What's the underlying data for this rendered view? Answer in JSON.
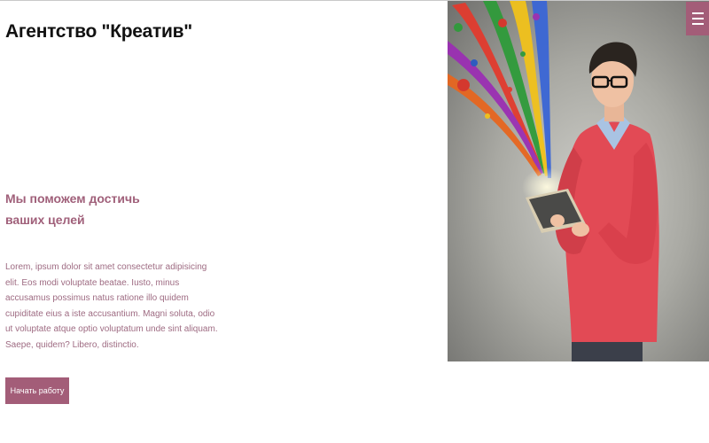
{
  "header": {
    "title": "Агентство \"Креатив\""
  },
  "hero": {
    "headline_line1": "Мы поможем достичь",
    "headline_line2": "ваших целей",
    "description": "Lorem, ipsum dolor sit amet consectetur adipisicing elit. Eos modi voluptate beatae. Iusto, minus accusamus possimus natus ratione illo quidem cupiditate eius a iste accusantium. Magni soluta, odio ut voluptate atque optio voluptatum unde sint aliquam. Saepe, quidem? Libero, distinctio.",
    "cta_label": "Начать работу",
    "image_subject": "man-with-tablet-paint-splash"
  },
  "menu": {
    "icon": "hamburger-menu-icon"
  },
  "colors": {
    "accent": "#a35d78",
    "headline": "#a0607a",
    "text": "#9e6b82",
    "title": "#111111"
  }
}
